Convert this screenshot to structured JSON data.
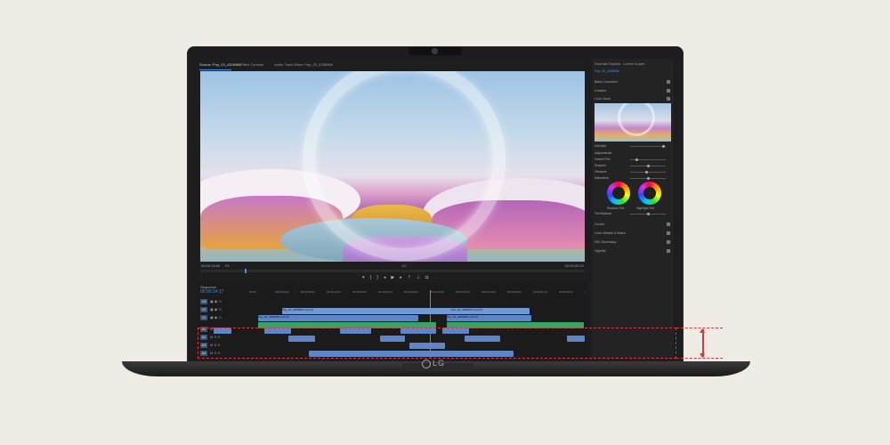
{
  "brand": {
    "logo_text": "LG"
  },
  "editor": {
    "tabs": [
      "Source: Pop_03_4306966",
      "Effect Controls",
      "Audio Track Mixer: Pop_03_4306966"
    ],
    "preview": {
      "timecode_left": "00:00:14:00",
      "fit": "Fit",
      "quality": "Full",
      "page": "1/2",
      "timecode_right": "00:00:56:22"
    },
    "transport_icons": [
      "marker-icon",
      "in-point-icon",
      "out-point-icon",
      "step-back-icon",
      "play-icon",
      "step-forward-icon",
      "lift-icon",
      "extract-icon",
      "export-frame-icon"
    ],
    "timeline": {
      "sequence": "Sequence",
      "timecode": "00:00:14:17",
      "ruler_labels": [
        "00:00",
        "00:00:04:23",
        "00:00:09:23",
        "00:00:14:23",
        "00:00:19:23",
        "00:00:24:23",
        "00:00:29:23",
        "00:00:34:23",
        "00:00:39:23",
        "00:00:44:23",
        "00:00:49:23",
        "00:00:54:23",
        "00:00:59:22",
        "00:01:04:22"
      ],
      "tracks": [
        "V3",
        "V2",
        "V1",
        "A1",
        "A2",
        "A3",
        "A4"
      ],
      "clip_label": "Pop_03_4306966.mp4 [V]"
    },
    "right_panel": {
      "tabs": [
        "Essential Graphics",
        "Lumetri Scopes"
      ],
      "source": "Pop_03_4306966",
      "sections": [
        {
          "label": "Basic Correction"
        },
        {
          "label": "Creative"
        },
        {
          "label": "Look: None"
        }
      ],
      "sliders": [
        {
          "label": "Intensity",
          "value": 0.92
        },
        {
          "label": "Faded Film",
          "value": 0.15
        },
        {
          "label": "Sharpen",
          "value": 0.5
        },
        {
          "label": "Vibrance",
          "value": 0.45
        },
        {
          "label": "Saturation",
          "value": 0.5
        }
      ],
      "adjustments_label": "Adjustments",
      "wheel_labels": [
        "Shadow Tint",
        "Highlight Tint"
      ],
      "tint_balance": "Tint Balance",
      "bottom_sections": [
        "Curves",
        "Color Wheels & Match",
        "HSL Secondary",
        "Vignette"
      ]
    }
  },
  "annotation": {
    "color": "#d9383f",
    "description_marker": "highlighted-region"
  }
}
